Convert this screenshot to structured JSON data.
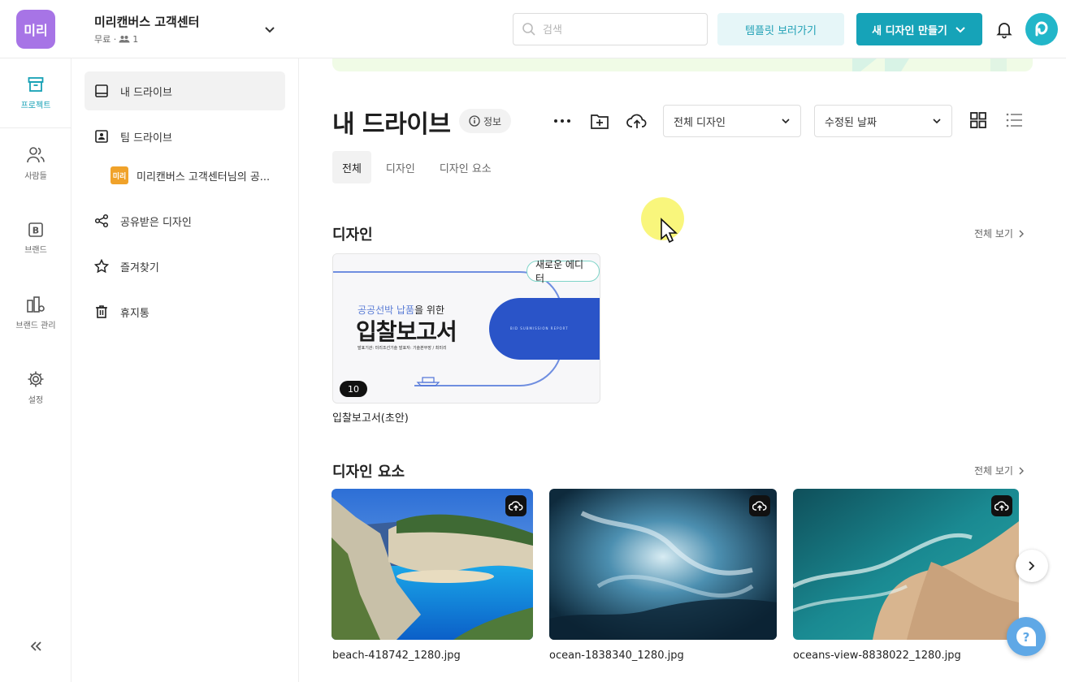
{
  "header": {
    "workspace_logo": "미리",
    "workspace_name": "미리캔버스 고객센터",
    "plan": "무료 ·",
    "member_count": "1",
    "search_placeholder": "검색",
    "template_button": "템플릿 보러가기",
    "new_design_button": "새 디자인 만들기"
  },
  "rail": {
    "items": [
      {
        "label": "프로젝트",
        "icon": "archive-icon"
      },
      {
        "label": "사람들",
        "icon": "people-icon"
      },
      {
        "label": "브랜드",
        "icon": "brand-icon"
      },
      {
        "label": "브랜드 관리",
        "icon": "brand-manage-icon"
      },
      {
        "label": "설정",
        "icon": "gear-icon"
      }
    ]
  },
  "sidebar": {
    "items": [
      {
        "label": "내 드라이브",
        "icon": "drive-icon"
      },
      {
        "label": "팀 드라이브",
        "icon": "team-drive-icon"
      },
      {
        "label": "공유받은 디자인",
        "icon": "share-icon"
      },
      {
        "label": "즐겨찾기",
        "icon": "star-icon"
      },
      {
        "label": "휴지통",
        "icon": "trash-icon"
      }
    ],
    "sub_item": {
      "badge": "미리",
      "label": "미리캔버스 고객센터님의 공..."
    }
  },
  "main": {
    "title": "내 드라이브",
    "info_label": "정보",
    "filter_type": "전체 디자인",
    "sort_by": "수정된 날짜",
    "tabs": [
      "전체",
      "디자인",
      "디자인 요소"
    ],
    "designs_section": "디자인",
    "elements_section": "디자인 요소",
    "see_all": "전체 보기"
  },
  "design_card": {
    "badge": "새로운 에디터",
    "page_count": "10",
    "thumb_small_accent": "공공선박 납품",
    "thumb_small_rest": "을 위한",
    "thumb_big": "입찰보고서",
    "thumb_band": "BID SUBMISSION REPORT",
    "thumb_meta": "발표기관: 미리조선기술    발표자: 기술본부장 / 최미리",
    "name": "입찰보고서(초안)"
  },
  "elements": [
    {
      "name": "beach-418742_1280.jpg"
    },
    {
      "name": "ocean-1838340_1280.jpg"
    },
    {
      "name": "oceans-view-8838022_1280.jpg"
    }
  ],
  "colors": {
    "accent": "#16a3b8",
    "workspace_logo": "#a774e6",
    "badge_orange": "#f0a22a",
    "help": "#5fa8e6"
  }
}
